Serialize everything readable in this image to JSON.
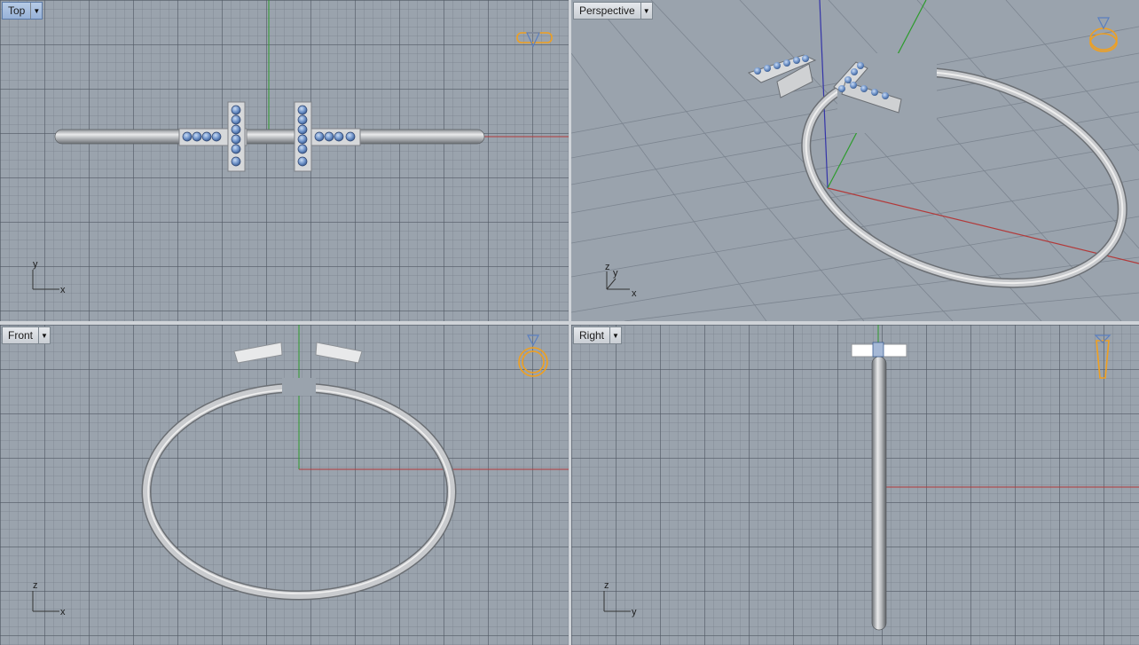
{
  "viewports": [
    {
      "id": "top",
      "label": "Top",
      "active": true,
      "axes": {
        "a": "x",
        "b": "y"
      }
    },
    {
      "id": "perspective",
      "label": "Perspective",
      "active": false,
      "axes": {
        "a": "x",
        "b": "y",
        "c": "z"
      }
    },
    {
      "id": "front",
      "label": "Front",
      "active": false,
      "axes": {
        "a": "x",
        "b": "z"
      }
    },
    {
      "id": "right",
      "label": "Right",
      "active": false,
      "axes": {
        "a": "y",
        "b": "z"
      }
    }
  ],
  "icons": {
    "dropdown": "dropdown-arrow-icon",
    "ring_top": "ring-top-view-icon",
    "ring_persp": "ring-perspective-icon",
    "ring_front": "ring-front-view-icon",
    "ring_side": "ring-side-view-icon"
  },
  "colors": {
    "background": "#9aa3ad",
    "grid_major": "#505862",
    "axis_x": "#b23a3a",
    "axis_y": "#2d9b2d",
    "axis_z": "#3434a8",
    "active_tab": "#a7bfe0",
    "ring_icon": "#f0a020",
    "gem": "#6f93c9",
    "metal": "#c9cbce"
  }
}
